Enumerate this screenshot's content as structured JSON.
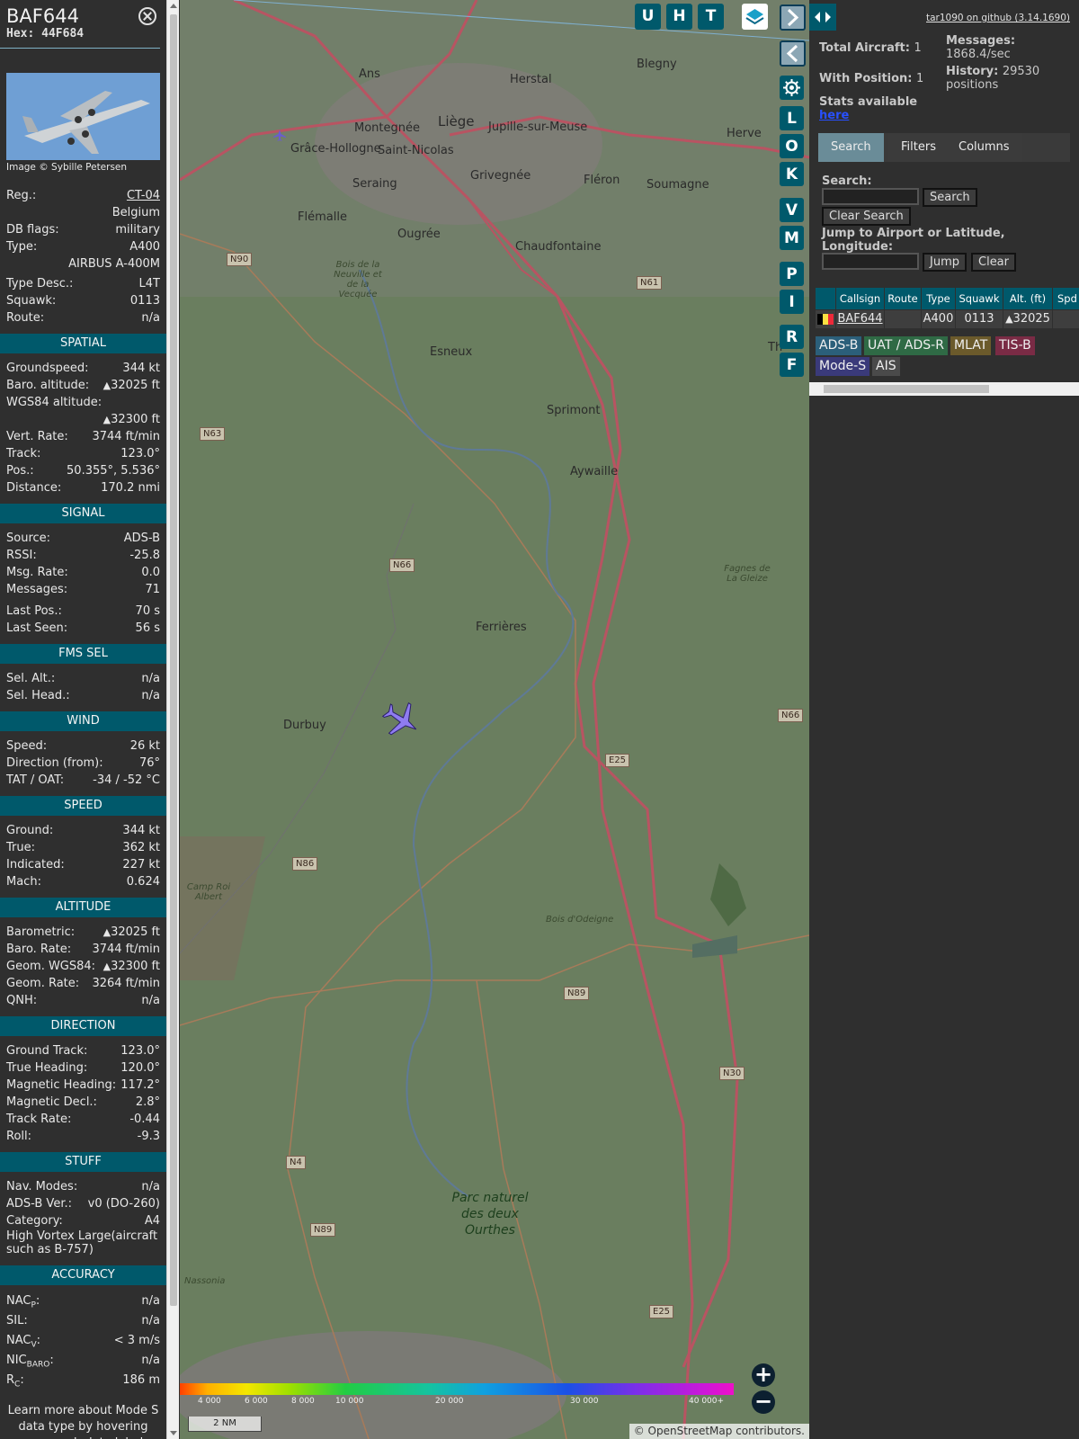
{
  "aircraft": {
    "callsign": "BAF644",
    "hex_label": "Hex:",
    "hex": "44F684",
    "photo_credit": "Image © Sybille Petersen"
  },
  "details": {
    "reg_label": "Reg.:",
    "reg": "CT-04",
    "country": "Belgium",
    "dbflags_label": "DB flags:",
    "dbflags": "military",
    "type_label": "Type:",
    "type": "A400",
    "type_full": "AIRBUS A-400M",
    "typedesc_label": "Type Desc.:",
    "typedesc": "L4T",
    "squawk_label": "Squawk:",
    "squawk": "0113",
    "route_label": "Route:",
    "route": "n/a"
  },
  "spatial": {
    "title": "SPATIAL",
    "gs_label": "Groundspeed:",
    "gs": "344 kt",
    "baro_label": "Baro. altitude:",
    "baro": "32025 ft",
    "wgs_label": "WGS84 altitude:",
    "wgs": "32300 ft",
    "vr_label": "Vert. Rate:",
    "vr": "3744 ft/min",
    "track_label": "Track:",
    "track": "123.0°",
    "pos_label": "Pos.:",
    "pos": "50.355°, 5.536°",
    "dist_label": "Distance:",
    "dist": "170.2 nmi"
  },
  "signal": {
    "title": "SIGNAL",
    "source_label": "Source:",
    "source": "ADS-B",
    "rssi_label": "RSSI:",
    "rssi": "-25.8",
    "msgrate_label": "Msg. Rate:",
    "msgrate": "0.0",
    "messages_label": "Messages:",
    "messages": "71",
    "lastpos_label": "Last Pos.:",
    "lastpos": "70 s",
    "lastseen_label": "Last Seen:",
    "lastseen": "56 s"
  },
  "fms": {
    "title": "FMS SEL",
    "alt_label": "Sel. Alt.:",
    "alt": "n/a",
    "head_label": "Sel. Head.:",
    "head": "n/a"
  },
  "wind": {
    "title": "WIND",
    "speed_label": "Speed:",
    "speed": "26 kt",
    "dir_label": "Direction (from):",
    "dir": "76°",
    "tat_label": "TAT / OAT:",
    "tat": "-34 / -52 °C"
  },
  "speed": {
    "title": "SPEED",
    "ground_label": "Ground:",
    "ground": "344 kt",
    "true_label": "True:",
    "true": "362 kt",
    "ind_label": "Indicated:",
    "ind": "227 kt",
    "mach_label": "Mach:",
    "mach": "0.624"
  },
  "altitude": {
    "title": "ALTITUDE",
    "baro_label": "Barometric:",
    "baro": "32025 ft",
    "barorate_label": "Baro. Rate:",
    "barorate": "3744 ft/min",
    "geom_label": "Geom. WGS84:",
    "geom": "32300 ft",
    "geomrate_label": "Geom. Rate:",
    "geomrate": "3264 ft/min",
    "qnh_label": "QNH:",
    "qnh": "n/a"
  },
  "direction": {
    "title": "DIRECTION",
    "gt_label": "Ground Track:",
    "gt": "123.0°",
    "th_label": "True Heading:",
    "th": "120.0°",
    "mh_label": "Magnetic Heading:",
    "mh": "117.2°",
    "md_label": "Magnetic Decl.:",
    "md": "2.8°",
    "tr_label": "Track Rate:",
    "tr": "-0.44",
    "roll_label": "Roll:",
    "roll": "-9.3"
  },
  "stuff": {
    "title": "STUFF",
    "nav_label": "Nav. Modes:",
    "nav": "n/a",
    "adsb_label": "ADS-B Ver.:",
    "adsb": "v0 (DO-260)",
    "cat_label": "Category:",
    "cat": "A4",
    "cat_desc": "High Vortex Large(aircraft such as B-757)"
  },
  "accuracy": {
    "title": "ACCURACY",
    "nacp_label": "NAC",
    "nacp_sub": "P",
    "nacp": "n/a",
    "sil_label": "SIL:",
    "sil": "n/a",
    "nacv_label": "NAC",
    "nacv_sub": "V",
    "nacv": "< 3 m/s",
    "nic_label": "NIC",
    "nic_sub": "BARO",
    "nic": "n/a",
    "rc_label": "R",
    "rc_sub": "C",
    "rc": "186 m"
  },
  "learn_more": "Learn more about Mode S data type by hovering over each data label",
  "map": {
    "buttons_top": [
      "U",
      "H",
      "T"
    ],
    "buttons_side": [
      "L",
      "O",
      "K",
      "V",
      "M",
      "P",
      "I",
      "R",
      "F"
    ],
    "places": {
      "liege": "Liège",
      "herstal": "Herstal",
      "blegny": "Blegny",
      "ans": "Ans",
      "montegnee": "Montegnée",
      "grace": "Grâce-Hollogne",
      "stnicolas": "Saint-Nicolas",
      "jupille": "Jupille-sur-Meuse",
      "herve": "Herve",
      "seraing": "Seraing",
      "grivegnee": "Grivegnée",
      "fleron": "Fléron",
      "soumagne": "Soumagne",
      "flemalle": "Flémalle",
      "ougree": "Ougrée",
      "chaudfontaine": "Chaudfontaine",
      "esneux": "Esneux",
      "sprimont": "Sprimont",
      "aywaille": "Aywaille",
      "ferrieres": "Ferrières",
      "durbuy": "Durbuy",
      "th": "Th",
      "neuville": "Bois de la Neuville et de la Vecquée",
      "fagnes": "Fagnes de La Gleize",
      "camp": "Camp Roi Albert",
      "bois_odeigne": "Bois d'Odeigne",
      "nassonia": "Nassonia",
      "park": "Parc naturel des deux Ourthes"
    },
    "roads": {
      "n90": "N90",
      "n61": "N61",
      "n63": "N63",
      "n66": "N66",
      "n66b": "N66",
      "e25": "E25",
      "n86": "N86",
      "n89": "N89",
      "n30": "N30",
      "n4": "N4",
      "n89b": "N89",
      "e25b": "E25"
    },
    "alt_labels": [
      "4 000",
      "6 000",
      "8 000",
      "10 000",
      "20 000",
      "30 000",
      "40 000+"
    ],
    "scale": "2 NM",
    "attribution_prefix": "© ",
    "attribution_link": "OpenStreetMap",
    "attribution_suffix": " contributors."
  },
  "sidebar": {
    "github": "tar1090 on github (3.14.1690)",
    "total_label": "Total Aircraft:",
    "total": "1",
    "pos_label": "With Position:",
    "pos": "1",
    "stats_label": "Stats available",
    "stats_link": "here",
    "messages_label": "Messages:",
    "messages": "1868.4/sec",
    "history_label": "History:",
    "history": "29530 positions",
    "tabs": [
      "Search",
      "Filters",
      "Columns"
    ],
    "search_label": "Search:",
    "search_btn": "Search",
    "clear_search_btn": "Clear Search",
    "jump_label": "Jump to Airport or Latitude, Longitude:",
    "jump_btn": "Jump",
    "clear_btn": "Clear",
    "table_headers": [
      "Callsign",
      "Route",
      "Type",
      "Squawk",
      "Alt. (ft)",
      "Spd"
    ],
    "table_row": {
      "callsign": "BAF644",
      "route": "",
      "type": "A400",
      "squawk": "0113",
      "alt": "32025"
    },
    "chips": [
      "ADS-B",
      "UAT / ADS-R",
      "MLAT",
      "TIS-B",
      "Mode-S",
      "AIS"
    ]
  },
  "colors": {
    "accent": "#00596b",
    "chip_adsb": "#2b5f7a",
    "chip_uat": "#2f6a45",
    "chip_mlat": "#6b5a2b",
    "chip_tisb": "#7a2b45",
    "chip_modes": "#3a3a7a",
    "chip_ais": "#4a4a4a"
  }
}
